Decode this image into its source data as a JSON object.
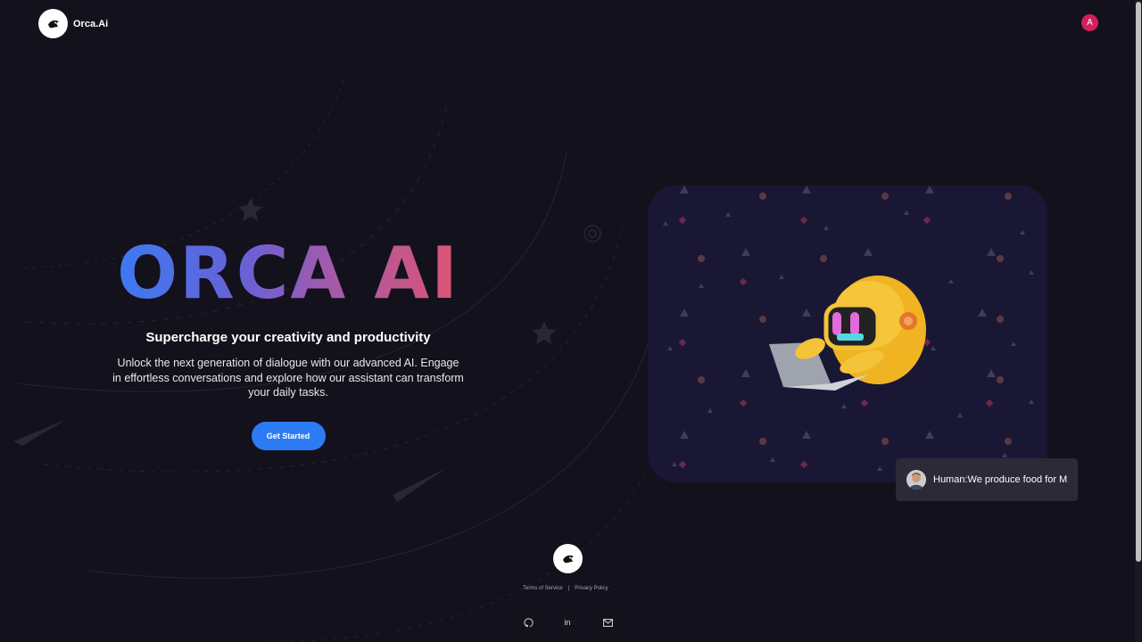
{
  "header": {
    "brand": "Orca.Ai",
    "avatar_initial": "A"
  },
  "hero": {
    "title": "ORCA AI",
    "subtitle": "Supercharge your creativity and productivity",
    "description": "Unlock the next generation of dialogue with our advanced AI. Engage in effortless conversations and explore how our assistant can transform your daily tasks.",
    "cta_label": "Get Started"
  },
  "chat_preview": {
    "text": "Human:We produce food for M"
  },
  "footer": {
    "terms": "Terms of Service",
    "separator": "|",
    "privacy": "Privacy Policy",
    "social": [
      {
        "name": "github-icon"
      },
      {
        "name": "linkedin-icon",
        "glyph": "in"
      },
      {
        "name": "mail-icon"
      }
    ]
  },
  "colors": {
    "background": "#13111c",
    "accent": "#2c7bf3",
    "avatar": "#d21f5d",
    "card": "#1a1735"
  }
}
